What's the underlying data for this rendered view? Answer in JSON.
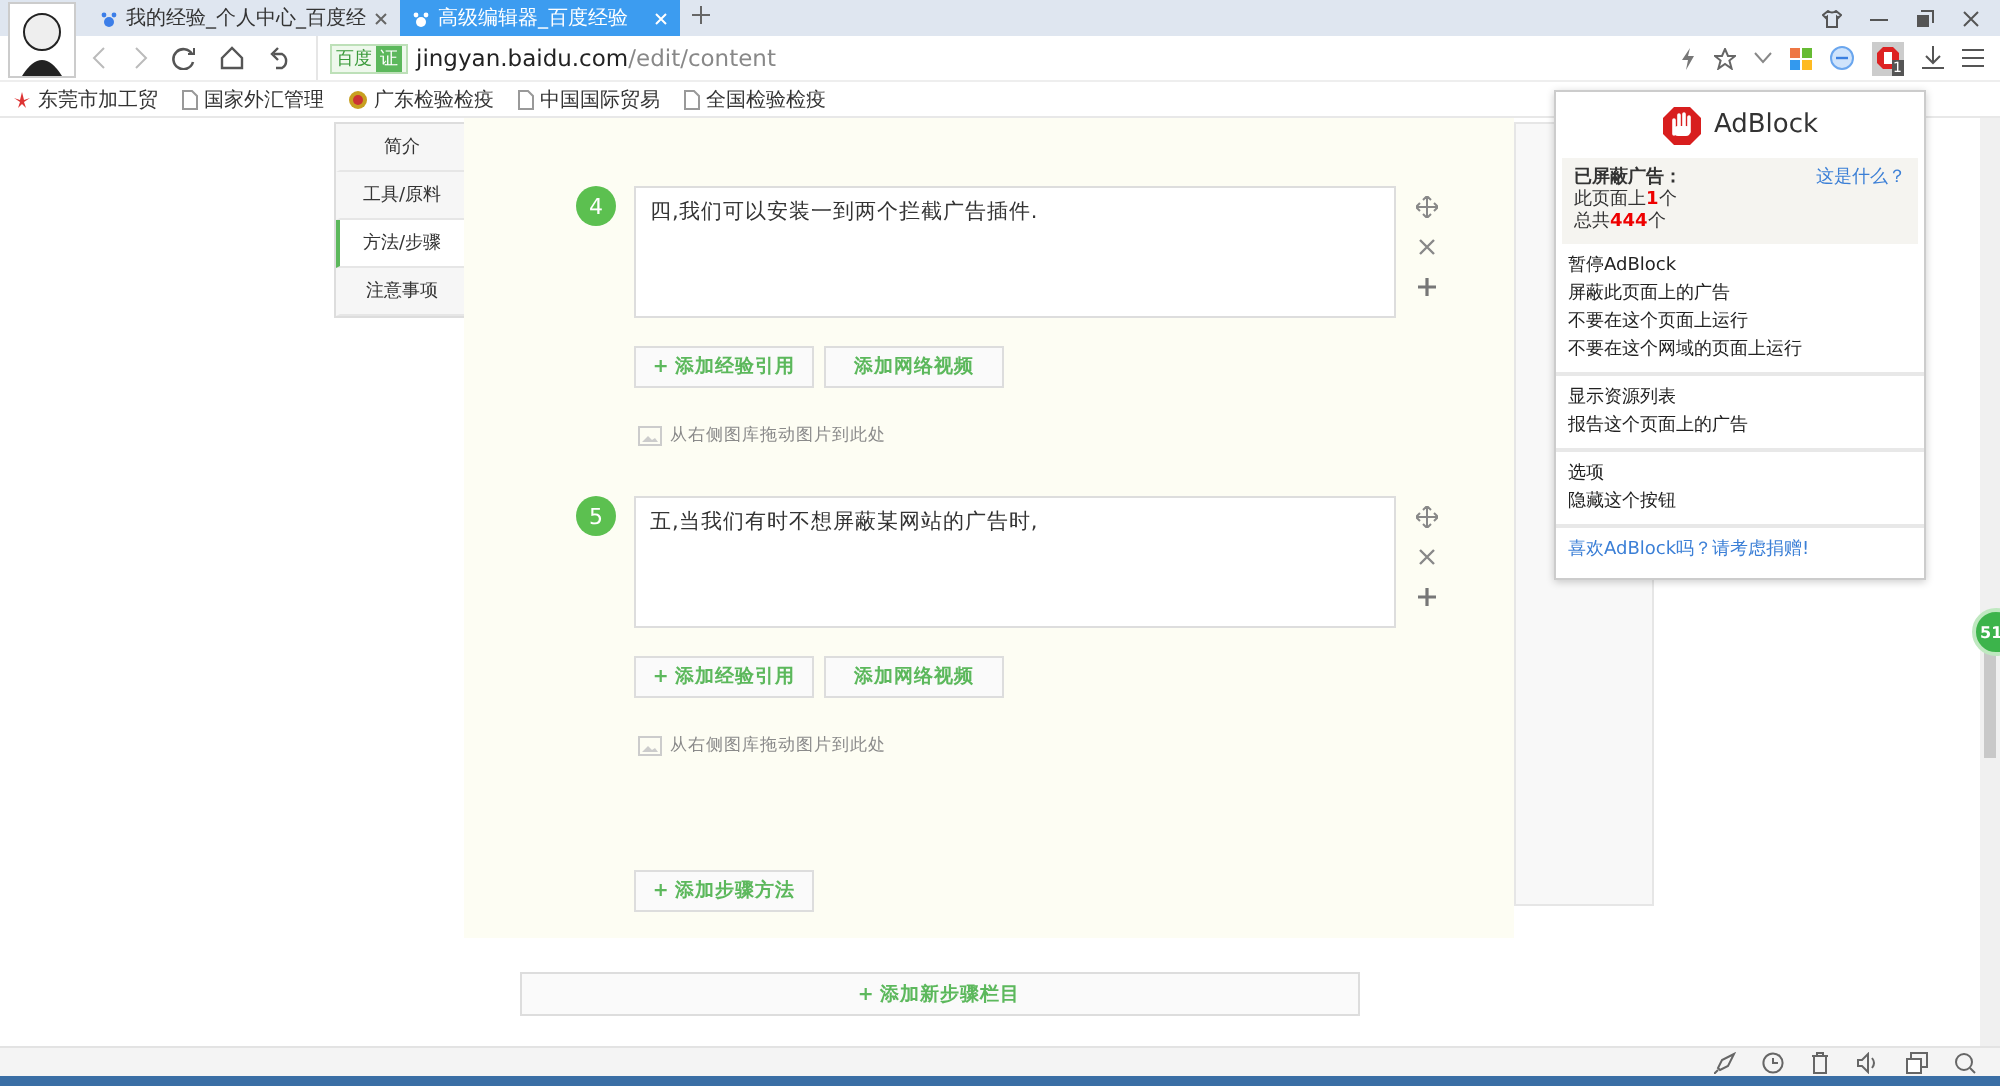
{
  "browser": {
    "tabs": [
      {
        "label": "我的经验_个人中心_百度经",
        "selected": false
      },
      {
        "label": "高级编辑器_百度经验",
        "selected": true
      }
    ],
    "address": {
      "badge": "百度",
      "verified": "证",
      "host": "jingyan.baidu.com",
      "path": "/edit/content"
    },
    "adblock_count": "1",
    "bookmarks": [
      {
        "label": "东莞市加工贸",
        "kind": "logo"
      },
      {
        "label": "国家外汇管理",
        "kind": "page"
      },
      {
        "label": "广东检验检疫",
        "kind": "emblem"
      },
      {
        "label": "中国国际贸易",
        "kind": "page"
      },
      {
        "label": "全国检验检疫",
        "kind": "page"
      }
    ]
  },
  "nav": [
    {
      "label": "简介",
      "selected": false
    },
    {
      "label": "工具/原料",
      "selected": false
    },
    {
      "label": "方法/步骤",
      "selected": true
    },
    {
      "label": "注意事项",
      "selected": false
    }
  ],
  "steps": [
    {
      "number": "4",
      "text": "四,我们可以安装一到两个拦截广告插件.",
      "quote_button": "+ 添加经验引用",
      "video_button": "添加网络视频",
      "image_hint": "从右侧图库拖动图片到此处"
    },
    {
      "number": "5",
      "text": "五,当我们有时不想屏蔽某网站的广告时,",
      "quote_button": "+ 添加经验引用",
      "video_button": "添加网络视频",
      "image_hint": "从右侧图库拖动图片到此处"
    }
  ],
  "add_step_button": "+ 添加步骤方法",
  "add_section_button": "+ 添加新步骤栏目",
  "popup": {
    "title": "AdBlock",
    "blocked_label": "已屏蔽广告：",
    "what_link": "这是什么？",
    "page_count": "此页面上**1**个",
    "total_count": "总共**444**个",
    "menu_groups": [
      [
        "暂停AdBlock",
        "屏蔽此页面上的广告",
        "不要在这个页面上运行",
        "不要在这个网域的页面上运行"
      ],
      [
        "显示资源列表",
        "报告这个页面上的广告"
      ],
      [
        "选项",
        "隐藏这个按钮"
      ]
    ],
    "footer_link": "喜欢AdBlock吗？请考虑捐赠!"
  },
  "side_badge": "51"
}
